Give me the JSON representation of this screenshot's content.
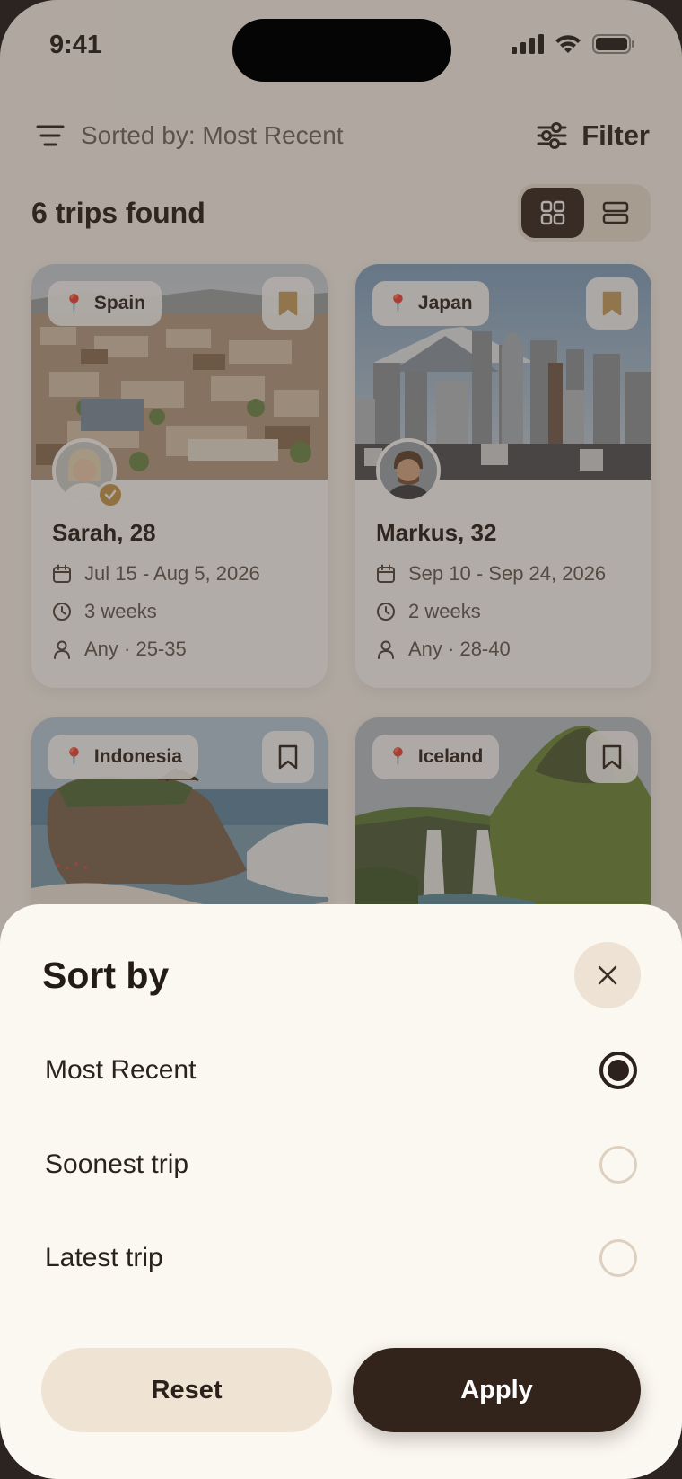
{
  "status_bar": {
    "time": "9:41"
  },
  "toolbar": {
    "sort_label": "Sorted by: Most Recent",
    "filter_label": "Filter"
  },
  "results": {
    "count_text": "6 trips found",
    "view_mode": "grid"
  },
  "trips": [
    {
      "location": "Spain",
      "name": "Sarah, 28",
      "dates": "Jul 15 - Aug 5, 2026",
      "duration": "3 weeks",
      "companions": "Any · 25-35",
      "bookmarked": true,
      "verified": true
    },
    {
      "location": "Japan",
      "name": "Markus, 32",
      "dates": "Sep 10 - Sep 24, 2026",
      "duration": "2 weeks",
      "companions": "Any · 28-40",
      "bookmarked": true,
      "verified": false
    },
    {
      "location": "Indonesia",
      "bookmarked": false
    },
    {
      "location": "Iceland",
      "bookmarked": false
    }
  ],
  "sort_sheet": {
    "title": "Sort by",
    "options": [
      {
        "label": "Most Recent",
        "selected": true
      },
      {
        "label": "Soonest trip",
        "selected": false
      },
      {
        "label": "Latest trip",
        "selected": false
      }
    ],
    "reset_label": "Reset",
    "apply_label": "Apply"
  },
  "colors": {
    "accent_dark": "#33241b",
    "sheet_bg": "#fbf7f1",
    "bookmark_fill": "#c9a063",
    "chip_bg": "#efe3d4"
  }
}
